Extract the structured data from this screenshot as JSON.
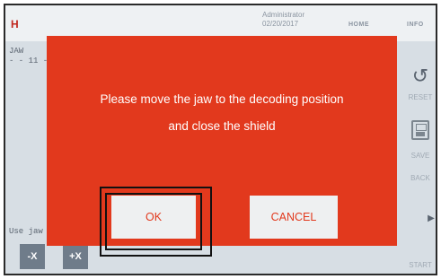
{
  "app": {
    "logo": "H",
    "user": "Administrator",
    "date": "02/20/2017",
    "nav_home": "HOME",
    "nav_info": "INFO"
  },
  "left_panel": {
    "title_line1": "JAW",
    "title_line2": "- - 11 -",
    "hint": "Use jaw"
  },
  "sidebar": {
    "reset_label": "RESET",
    "save_label": "SAVE",
    "back_label": "BACK",
    "start_label": "START"
  },
  "jog": {
    "minus_label": "-X",
    "plus_label": "+X"
  },
  "dialog": {
    "message_line1": "Please move the jaw to the decoding position",
    "message_line2": "and close the shield",
    "ok_label": "OK",
    "cancel_label": "CANCEL",
    "background_color": "#e2391d"
  }
}
